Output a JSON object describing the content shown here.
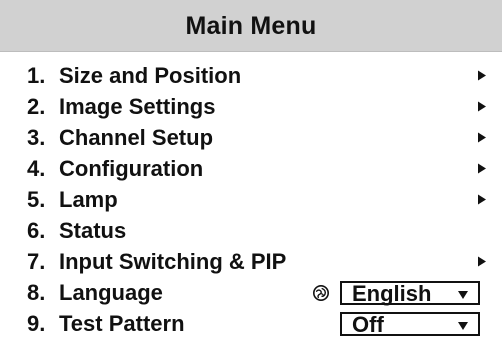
{
  "header": {
    "title": "Main Menu"
  },
  "menu": {
    "items": [
      {
        "number": "1.",
        "label": "Size and Position",
        "has_submenu": true
      },
      {
        "number": "2.",
        "label": "Image Settings",
        "has_submenu": true
      },
      {
        "number": "3.",
        "label": "Channel Setup",
        "has_submenu": true
      },
      {
        "number": "4.",
        "label": "Configuration",
        "has_submenu": true
      },
      {
        "number": "5.",
        "label": "Lamp",
        "has_submenu": true
      },
      {
        "number": "6.",
        "label": "Status",
        "has_submenu": false
      },
      {
        "number": "7.",
        "label": "Input Switching & PIP",
        "has_submenu": true
      },
      {
        "number": "8.",
        "label": "Language",
        "has_submenu": false,
        "icon": "globe-icon",
        "dropdown_value": "English"
      },
      {
        "number": "9.",
        "label": "Test Pattern",
        "has_submenu": false,
        "dropdown_value": "Off"
      }
    ]
  },
  "colors": {
    "header_bg": "#d1d1d1",
    "text": "#111111",
    "background": "#ffffff"
  }
}
